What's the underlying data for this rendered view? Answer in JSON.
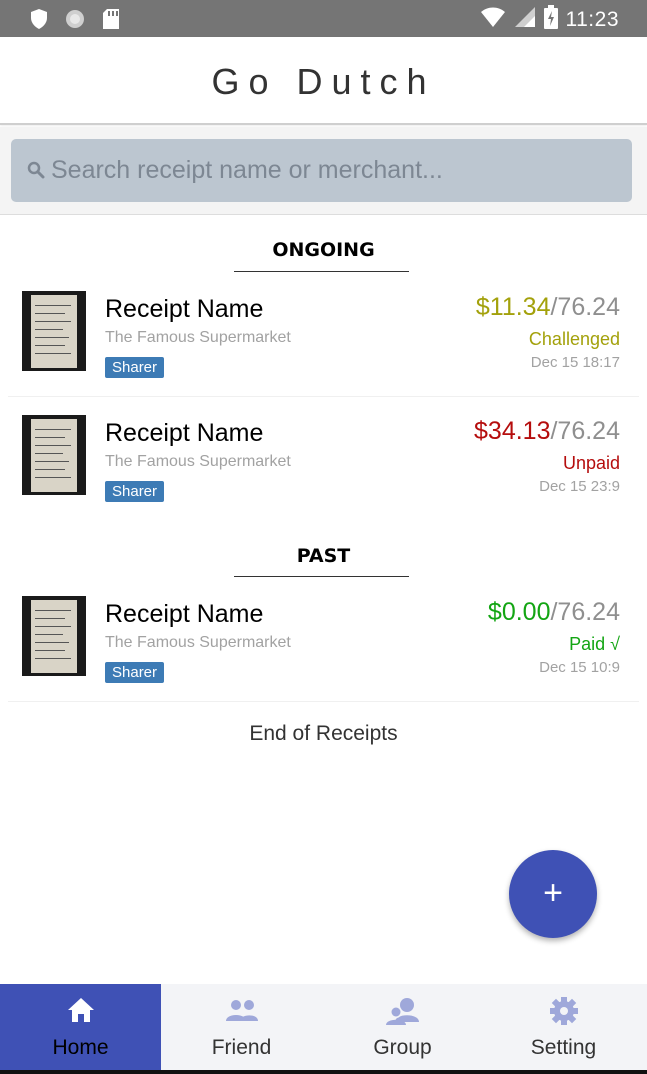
{
  "status_bar": {
    "time": "11:23",
    "icons": [
      "shield-icon",
      "circle-icon",
      "sd-card-icon",
      "wifi-icon",
      "signal-icon",
      "battery-icon"
    ]
  },
  "header": {
    "title": "Go Dutch"
  },
  "search": {
    "placeholder": "Search receipt name or merchant...",
    "value": ""
  },
  "sections": [
    {
      "title": "ONGOING",
      "receipts": [
        {
          "name": "Receipt Name",
          "merchant": "The Famous Supermarket",
          "role": "Sharer",
          "paid": "$11.34",
          "total": "/76.24",
          "status": "Challenged",
          "status_color": "#a3a10b",
          "amount_color": "#a3a10b",
          "date": "Dec 15 18:17"
        },
        {
          "name": "Receipt Name",
          "merchant": "The Famous Supermarket",
          "role": "Sharer",
          "paid": "$34.13",
          "total": "/76.24",
          "status": "Unpaid",
          "status_color": "#b50d0d",
          "amount_color": "#b50d0d",
          "date": "Dec 15 23:9"
        }
      ]
    },
    {
      "title": "PAST",
      "receipts": [
        {
          "name": "Receipt Name",
          "merchant": "The Famous Supermarket",
          "role": "Sharer",
          "paid": "$0.00",
          "total": "/76.24",
          "status": "Paid √",
          "status_color": "#13a513",
          "amount_color": "#13a513",
          "date": "Dec 15 10:9"
        }
      ]
    }
  ],
  "end_text": "End of Receipts",
  "fab_label": "+",
  "bottom_nav": [
    {
      "label": "Home",
      "icon": "home-icon",
      "active": true
    },
    {
      "label": "Friend",
      "icon": "people-icon",
      "active": false
    },
    {
      "label": "Group",
      "icon": "group-icon",
      "active": false
    },
    {
      "label": "Setting",
      "icon": "gear-icon",
      "active": false
    }
  ],
  "colors": {
    "accent": "#3f51b5",
    "tag": "#3d7bb5",
    "status_bar": "#757575",
    "search_bg": "#bcc6d0"
  }
}
